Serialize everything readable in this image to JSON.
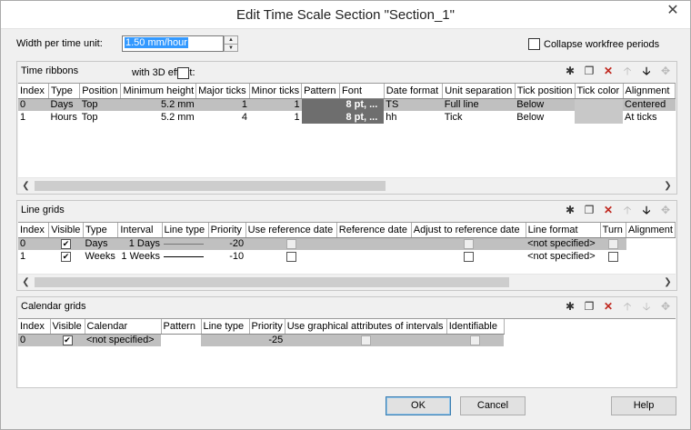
{
  "window": {
    "title": "Edit Time Scale Section \"Section_1\"",
    "close_glyph": "✕"
  },
  "width_per_time_unit": {
    "label": "Width per time unit:",
    "value": "1.50 mm/hour"
  },
  "collapse_workfree": {
    "label": "Collapse workfree periods",
    "checked": false
  },
  "time_ribbons": {
    "title": "Time ribbons",
    "effect_label": "with 3D effect:",
    "columns": [
      "Index",
      "Type",
      "Position",
      "Minimum height",
      "Major ticks",
      "Minor ticks",
      "Pattern",
      "Font",
      "Date format",
      "Unit separation",
      "Tick position",
      "Tick color",
      "Alignment"
    ],
    "rows": [
      {
        "index": "0",
        "type": "Days",
        "position": "Top",
        "min_height": "5.2 mm",
        "major": "1",
        "minor": "1",
        "font": "8 pt, ...",
        "date_format": "TS",
        "unit_sep": "Full line",
        "tick_pos": "Below",
        "alignment": "Centered"
      },
      {
        "index": "1",
        "type": "Hours",
        "position": "Top",
        "min_height": "5.2 mm",
        "major": "4",
        "minor": "1",
        "font": "8 pt, ...",
        "date_format": "hh",
        "unit_sep": "Tick",
        "tick_pos": "Below",
        "alignment": "At ticks"
      }
    ]
  },
  "line_grids": {
    "title": "Line grids",
    "columns": [
      "Index",
      "Visible",
      "Type",
      "Interval",
      "Line type",
      "Priority",
      "Use reference date",
      "Reference date",
      "Adjust to reference date",
      "Line format",
      "Turn",
      "Alignment"
    ],
    "rows": [
      {
        "index": "0",
        "type": "Days",
        "interval": "1 Days",
        "priority": "-20",
        "line_format": "<not specified>"
      },
      {
        "index": "1",
        "type": "Weeks",
        "interval": "1 Weeks",
        "priority": "-10",
        "line_format": "<not specified>"
      }
    ]
  },
  "calendar_grids": {
    "title": "Calendar grids",
    "columns": [
      "Index",
      "Visible",
      "Calendar",
      "Pattern",
      "Line type",
      "Priority",
      "Use graphical attributes of intervals",
      "Identifiable"
    ],
    "rows": [
      {
        "index": "0",
        "calendar": "<not specified>",
        "priority": "-25"
      }
    ]
  },
  "buttons": {
    "ok": "OK",
    "cancel": "Cancel",
    "help": "Help"
  },
  "icons": {
    "new": "✱",
    "copy": "❐",
    "delete": "✕",
    "up": "🡡",
    "down": "🡣",
    "move": "✥",
    "check": "✔",
    "arrow_left": "❮",
    "arrow_right": "❯",
    "spin_up": "▲",
    "spin_down": "▼"
  }
}
